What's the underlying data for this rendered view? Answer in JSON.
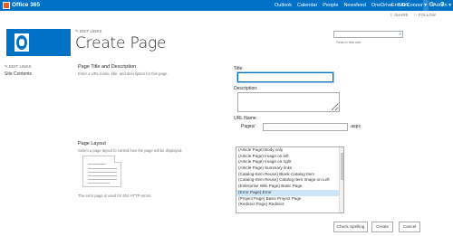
{
  "suite_bar": {
    "brand": "Office 365",
    "nav": [
      "Outlook",
      "Calendar",
      "People",
      "Newsfeed",
      "OneDrive",
      "Sites",
      "...",
      "Admin"
    ],
    "admin_arrow": "▾",
    "user": "Erin O'Connor ▾",
    "gear_glyph": "⚙",
    "help_glyph": "?"
  },
  "actions": {
    "share": "SHARE",
    "follow": "FOLLOW"
  },
  "header": {
    "edit_links": "EDIT LINKS",
    "title": "Create Page",
    "search_placeholder": "Search this site",
    "search_glyph": "⌕"
  },
  "left_nav": {
    "edit_links": "EDIT LINKS",
    "items": [
      "Site Contents"
    ]
  },
  "title_section": {
    "heading": "Page Title and Description",
    "description": "Enter a URL name, title, and description for this page.",
    "title_label": "Title:",
    "title_value": "",
    "description_label": "Description:",
    "description_value": "",
    "url_label": "URL Name:",
    "url_prefix": "Pages/",
    "url_value": "",
    "url_suffix": ".aspx"
  },
  "layout_section": {
    "heading": "Page Layout",
    "description": "Select a page layout to control how the page will be displayed.",
    "preview_caption": "The error page is used for 404 HTTP errors.",
    "options": [
      "(Article Page) Body only",
      "(Article Page) Image on left",
      "(Article Page) Image on right",
      "(Article Page) Summary links",
      "(Catalog-Item Reuse) Blank Catalog Item",
      "(Catalog-Item Reuse) Catalog Item Image on Left",
      "(Enterprise Wiki Page) Basic Page",
      "(Error Page) Error",
      "(Project Page) Basic Project Page",
      "(Redirect Page) Redirect"
    ],
    "selected_index": 7
  },
  "buttons": {
    "check_spelling": "Check Spelling",
    "create": "Create",
    "cancel": "Cancel"
  },
  "colors": {
    "suite_bar": "#0072c6",
    "accent": "#0072c6",
    "selected_option": "#cde6f7"
  }
}
